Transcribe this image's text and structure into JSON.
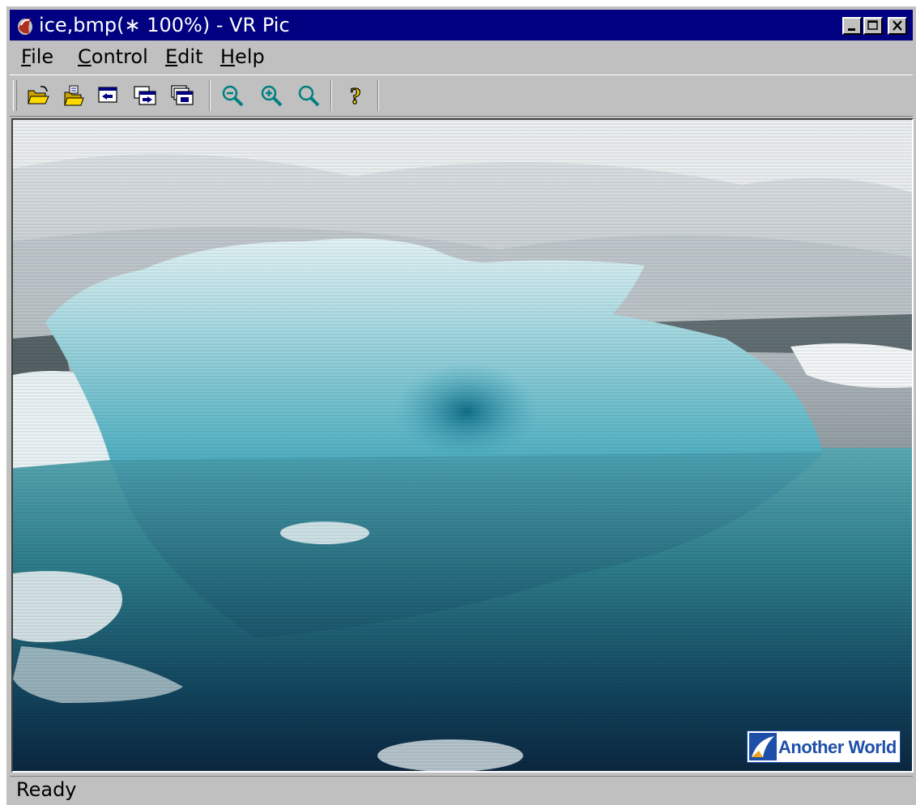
{
  "window": {
    "title": "ice,bmp(∗ 100%) - VR Pic"
  },
  "menu": {
    "file": "File",
    "control": "Control",
    "edit": "Edit",
    "help": "Help"
  },
  "toolbar": {
    "buttons": [
      "open-folder-icon",
      "open-recent-icon",
      "previous-image-icon",
      "next-image-icon",
      "slideshow-icon",
      "zoom-out-icon",
      "zoom-in-icon",
      "zoom-fit-icon",
      "help-icon"
    ]
  },
  "image": {
    "watermark": "Another World"
  },
  "status": {
    "text": "Ready"
  },
  "colors": {
    "title_bar": "#000080",
    "window_face": "#c0c0c0",
    "watermark_blue": "#1e4fa8"
  }
}
